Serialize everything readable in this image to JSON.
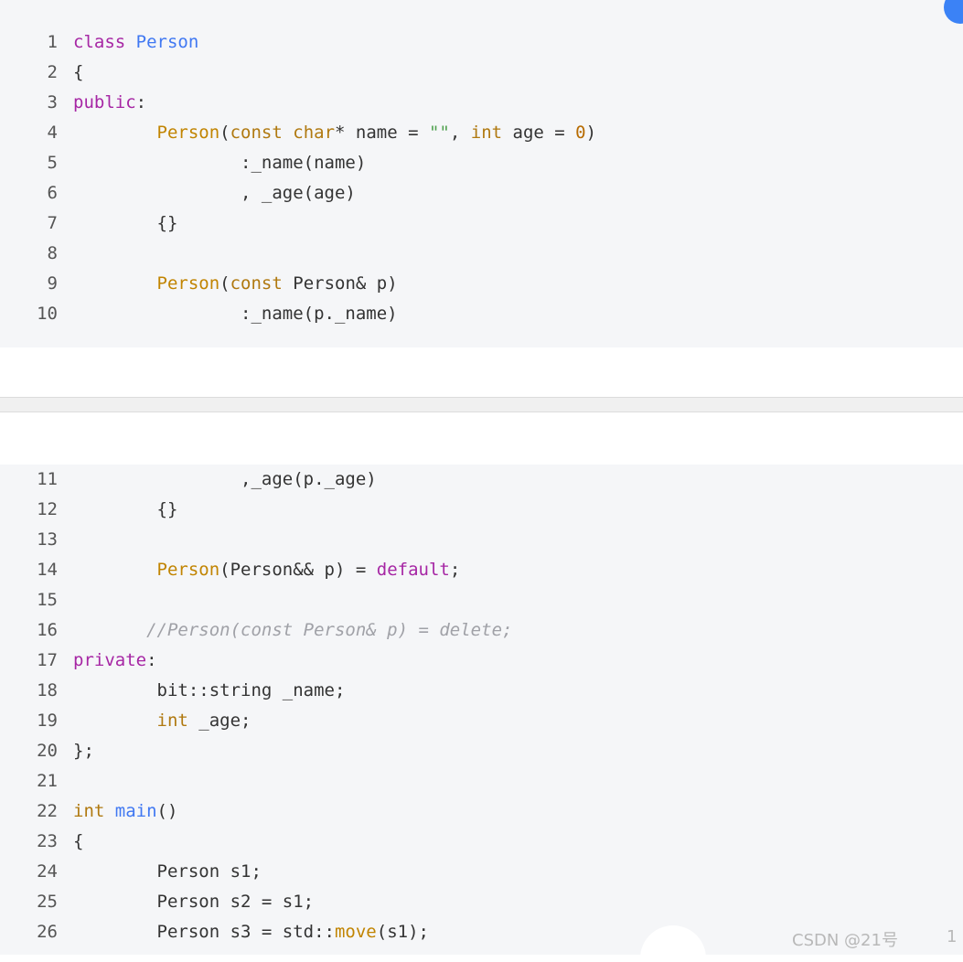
{
  "watermark": "CSDN @21号",
  "page_number": "1",
  "code_lines": [
    {
      "n": "1",
      "html": "<span class=\"kw\">class</span> <span class=\"fn\">Person</span>"
    },
    {
      "n": "2",
      "html": "{"
    },
    {
      "n": "3",
      "html": "<span class=\"kw\">public</span>:"
    },
    {
      "n": "4",
      "html": "        <span class=\"fnc\">Person</span>(<span class=\"ty\">const</span> <span class=\"ty\">char</span>* name = <span class=\"st\">\"\"</span>, <span class=\"ty\">int</span> age = <span class=\"nm\">0</span>)"
    },
    {
      "n": "5",
      "html": "                :_name(name)"
    },
    {
      "n": "6",
      "html": "                , _age(age)"
    },
    {
      "n": "7",
      "html": "        {}"
    },
    {
      "n": "8",
      "html": ""
    },
    {
      "n": "9",
      "html": "        <span class=\"fnc\">Person</span>(<span class=\"ty\">const</span> Person&amp; p)"
    },
    {
      "n": "10",
      "html": "                :_name(p._name)"
    },
    {
      "n": "11",
      "html": "                ,_age(p._age)"
    },
    {
      "n": "12",
      "html": "        {}"
    },
    {
      "n": "13",
      "html": ""
    },
    {
      "n": "14",
      "html": "        <span class=\"fnc\">Person</span>(Person&amp;&amp; p) = <span class=\"kw\">default</span>;"
    },
    {
      "n": "15",
      "html": ""
    },
    {
      "n": "16",
      "html": "       <span class=\"cm\">//Person(const Person&amp; p) = delete;</span>"
    },
    {
      "n": "17",
      "html": "<span class=\"kw\">private</span>:"
    },
    {
      "n": "18",
      "html": "        bit::string _name;"
    },
    {
      "n": "19",
      "html": "        <span class=\"ty\">int</span> _age;"
    },
    {
      "n": "20",
      "html": "};"
    },
    {
      "n": "21",
      "html": ""
    },
    {
      "n": "22",
      "html": "<span class=\"ty\">int</span> <span class=\"fn\">main</span>()"
    },
    {
      "n": "23",
      "html": "{"
    },
    {
      "n": "24",
      "html": "        Person s1;"
    },
    {
      "n": "25",
      "html": "        Person s2 = s1;"
    },
    {
      "n": "26",
      "html": "        Person s3 = std::<span class=\"fnc\">move</span>(s1);"
    }
  ]
}
